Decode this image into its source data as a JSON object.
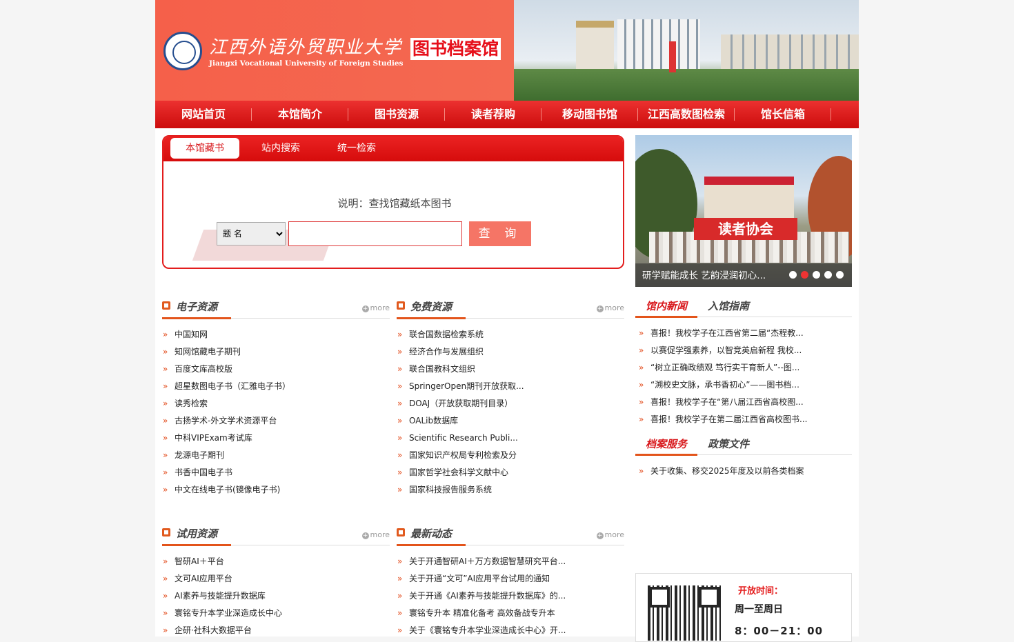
{
  "header": {
    "logo_cn": "江西外语外贸职业大学",
    "logo_en": "Jiangxi Vocational University of Foreign Studies",
    "library_name": "图书档案馆"
  },
  "nav": [
    {
      "label": "网站首页"
    },
    {
      "label": "本馆简介"
    },
    {
      "label": "图书资源"
    },
    {
      "label": "读者荐购"
    },
    {
      "label": "移动图书馆"
    },
    {
      "label": "江西高数图检索"
    },
    {
      "label": "馆长信箱"
    }
  ],
  "search": {
    "tabs": [
      "本馆藏书",
      "站内搜索",
      "统一检索"
    ],
    "description": "说明：查找馆藏纸本图书",
    "field_selected": "题 名",
    "query_value": "",
    "button_label": "查 询"
  },
  "slider": {
    "banner_text": "读者协会",
    "caption": "研学赋能成长 艺韵浸润初心...",
    "dot_count": 5,
    "active_dot": 2
  },
  "blocks": {
    "eresources": {
      "title": "电子资源",
      "more": "more",
      "items": [
        "中国知网",
        "知网馆藏电子期刊",
        "百度文库高校版",
        "超星数图电子书（汇雅电子书）",
        "读秀检索",
        "古扬学术-外文学术资源平台",
        "中科VIPExam考试库",
        "龙源电子期刊",
        "书香中国电子书",
        "中文在线电子书(镜像电子书)"
      ]
    },
    "free": {
      "title": "免费资源",
      "more": "more",
      "items": [
        "联合国数据检索系统",
        "经济合作与发展组织",
        "联合国教科文组织",
        "SpringerOpen期刊开放获取...",
        "DOAJ（开放获取期刊目录）",
        "OALib数据库",
        "Scientific Research Publi...",
        "国家知识产权局专利检索及分",
        "国家哲学社会科学文献中心",
        "国家科技报告服务系统"
      ]
    },
    "trial": {
      "title": "试用资源",
      "more": "more",
      "items": [
        "智研AI＋平台",
        "文可AI应用平台",
        "AI素养与技能提升数据库",
        "寰铭专升本学业深造成长中心",
        "企研·社科大数据平台"
      ]
    },
    "latest": {
      "title": "最新动态",
      "more": "more",
      "items": [
        "关于开通智研AI＋万方数据智慧研究平台...",
        "关于开通“文可”AI应用平台试用的通知",
        "关于开通《AI素养与技能提升数据库》的...",
        "寰铭专升本 精准化备考 高效备战专升本",
        "关于《寰铭专升本学业深造成长中心》开..."
      ]
    }
  },
  "news_panel": {
    "tabs": [
      "馆内新闻",
      "入馆指南"
    ],
    "items": [
      "喜报！我校学子在江西省第二届“杰程教...",
      "以赛促学强素养，以智竞英启新程 我校...",
      "“树立正确政绩观 笃行实干育新人”--图...",
      "“溯校史文脉，承书香初心”——图书档...",
      "喜报！我校学子在“第八届江西省高校图...",
      "喜报！我校学子在第二届江西省高校图书..."
    ]
  },
  "archive_panel": {
    "tabs": [
      "档案服务",
      "政策文件"
    ],
    "items": [
      "关于收集、移交2025年度及以前各类档案"
    ]
  },
  "hours": {
    "title": "开放时间：",
    "days": "周一至周日",
    "time": "8：00－21：00"
  },
  "colors": {
    "primary_red": "#d8181c",
    "accent_orange": "#e3541b",
    "header_coral": "#f5604a"
  }
}
